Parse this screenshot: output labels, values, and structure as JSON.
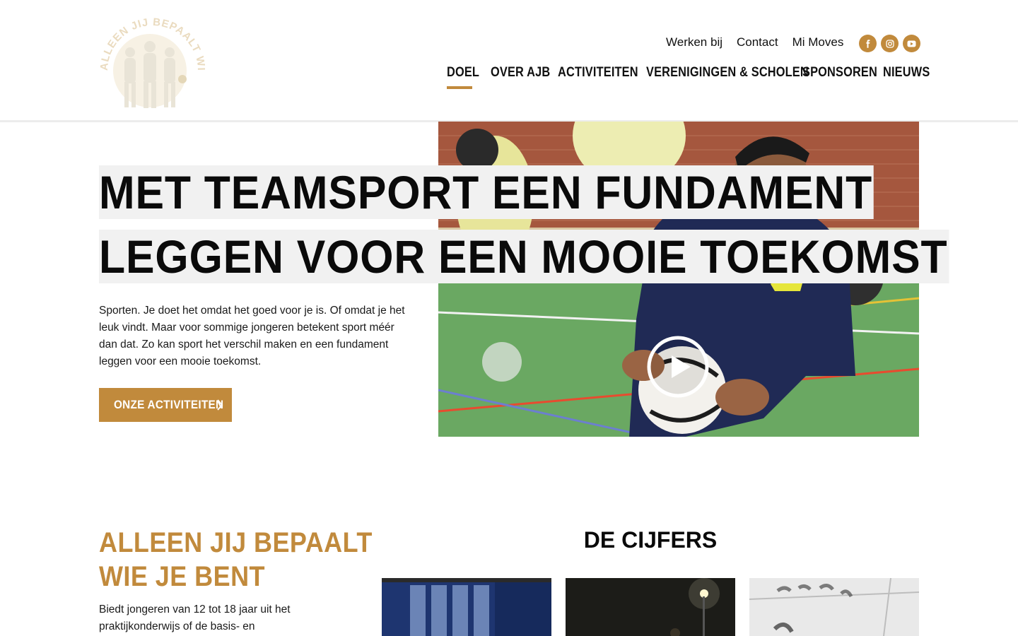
{
  "header": {
    "logo_text": "ALLEEN JIJ BEPAALT WIE JE BENT",
    "util_nav": [
      "Werken bij",
      "Contact",
      "Mi Moves"
    ],
    "social": [
      "facebook-icon",
      "instagram-icon",
      "youtube-icon"
    ],
    "main_nav": [
      "DOEL",
      "OVER AJB",
      "ACTIVITEITEN",
      "VERENIGINGEN & SCHOLEN",
      "SPONSOREN",
      "NIEUWS"
    ],
    "active_nav": "DOEL"
  },
  "hero": {
    "title_lines": [
      "MET TEAMSPORT EEN FUNDAMENT",
      "LEGGEN VOOR EEN MOOIE TOEKOMST"
    ],
    "text": "Sporten. Je doet het omdat het goed voor je is. Of omdat je het leuk vindt. Maar voor sommige jongeren betekent sport méér dan dat. Zo kan sport het verschil maken en een fundament leggen voor een mooie toekomst.",
    "cta_label": "ONZE ACTIVITEITEN",
    "media": "play-icon"
  },
  "section": {
    "title_lines": [
      "ALLEEN JIJ BEPAALT",
      "WIE JE BENT"
    ],
    "text": "Biedt jongeren van 12 tot 18 jaar uit het praktijkonderwijs of de basis- en",
    "cijfers_title": "DE CIJFERS"
  },
  "colors": {
    "accent": "#c18a3c",
    "title_bg": "#f1f1f1",
    "court_green": "#5f9e5a"
  }
}
